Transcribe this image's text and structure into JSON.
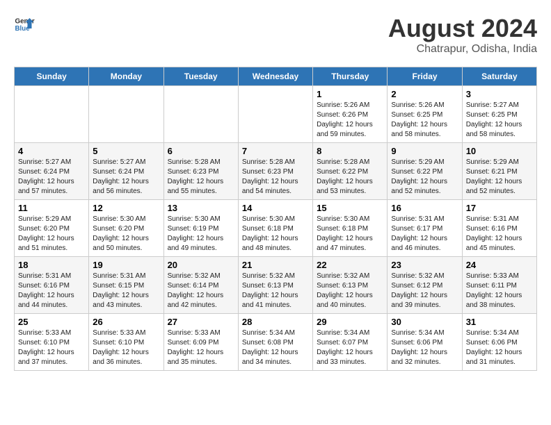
{
  "header": {
    "logo_line1": "General",
    "logo_line2": "Blue",
    "month_title": "August 2024",
    "subtitle": "Chatrapur, Odisha, India"
  },
  "days_of_week": [
    "Sunday",
    "Monday",
    "Tuesday",
    "Wednesday",
    "Thursday",
    "Friday",
    "Saturday"
  ],
  "weeks": [
    [
      {
        "day": "",
        "info": ""
      },
      {
        "day": "",
        "info": ""
      },
      {
        "day": "",
        "info": ""
      },
      {
        "day": "",
        "info": ""
      },
      {
        "day": "1",
        "info": "Sunrise: 5:26 AM\nSunset: 6:26 PM\nDaylight: 12 hours\nand 59 minutes."
      },
      {
        "day": "2",
        "info": "Sunrise: 5:26 AM\nSunset: 6:25 PM\nDaylight: 12 hours\nand 58 minutes."
      },
      {
        "day": "3",
        "info": "Sunrise: 5:27 AM\nSunset: 6:25 PM\nDaylight: 12 hours\nand 58 minutes."
      }
    ],
    [
      {
        "day": "4",
        "info": "Sunrise: 5:27 AM\nSunset: 6:24 PM\nDaylight: 12 hours\nand 57 minutes."
      },
      {
        "day": "5",
        "info": "Sunrise: 5:27 AM\nSunset: 6:24 PM\nDaylight: 12 hours\nand 56 minutes."
      },
      {
        "day": "6",
        "info": "Sunrise: 5:28 AM\nSunset: 6:23 PM\nDaylight: 12 hours\nand 55 minutes."
      },
      {
        "day": "7",
        "info": "Sunrise: 5:28 AM\nSunset: 6:23 PM\nDaylight: 12 hours\nand 54 minutes."
      },
      {
        "day": "8",
        "info": "Sunrise: 5:28 AM\nSunset: 6:22 PM\nDaylight: 12 hours\nand 53 minutes."
      },
      {
        "day": "9",
        "info": "Sunrise: 5:29 AM\nSunset: 6:22 PM\nDaylight: 12 hours\nand 52 minutes."
      },
      {
        "day": "10",
        "info": "Sunrise: 5:29 AM\nSunset: 6:21 PM\nDaylight: 12 hours\nand 52 minutes."
      }
    ],
    [
      {
        "day": "11",
        "info": "Sunrise: 5:29 AM\nSunset: 6:20 PM\nDaylight: 12 hours\nand 51 minutes."
      },
      {
        "day": "12",
        "info": "Sunrise: 5:30 AM\nSunset: 6:20 PM\nDaylight: 12 hours\nand 50 minutes."
      },
      {
        "day": "13",
        "info": "Sunrise: 5:30 AM\nSunset: 6:19 PM\nDaylight: 12 hours\nand 49 minutes."
      },
      {
        "day": "14",
        "info": "Sunrise: 5:30 AM\nSunset: 6:18 PM\nDaylight: 12 hours\nand 48 minutes."
      },
      {
        "day": "15",
        "info": "Sunrise: 5:30 AM\nSunset: 6:18 PM\nDaylight: 12 hours\nand 47 minutes."
      },
      {
        "day": "16",
        "info": "Sunrise: 5:31 AM\nSunset: 6:17 PM\nDaylight: 12 hours\nand 46 minutes."
      },
      {
        "day": "17",
        "info": "Sunrise: 5:31 AM\nSunset: 6:16 PM\nDaylight: 12 hours\nand 45 minutes."
      }
    ],
    [
      {
        "day": "18",
        "info": "Sunrise: 5:31 AM\nSunset: 6:16 PM\nDaylight: 12 hours\nand 44 minutes."
      },
      {
        "day": "19",
        "info": "Sunrise: 5:31 AM\nSunset: 6:15 PM\nDaylight: 12 hours\nand 43 minutes."
      },
      {
        "day": "20",
        "info": "Sunrise: 5:32 AM\nSunset: 6:14 PM\nDaylight: 12 hours\nand 42 minutes."
      },
      {
        "day": "21",
        "info": "Sunrise: 5:32 AM\nSunset: 6:13 PM\nDaylight: 12 hours\nand 41 minutes."
      },
      {
        "day": "22",
        "info": "Sunrise: 5:32 AM\nSunset: 6:13 PM\nDaylight: 12 hours\nand 40 minutes."
      },
      {
        "day": "23",
        "info": "Sunrise: 5:32 AM\nSunset: 6:12 PM\nDaylight: 12 hours\nand 39 minutes."
      },
      {
        "day": "24",
        "info": "Sunrise: 5:33 AM\nSunset: 6:11 PM\nDaylight: 12 hours\nand 38 minutes."
      }
    ],
    [
      {
        "day": "25",
        "info": "Sunrise: 5:33 AM\nSunset: 6:10 PM\nDaylight: 12 hours\nand 37 minutes."
      },
      {
        "day": "26",
        "info": "Sunrise: 5:33 AM\nSunset: 6:10 PM\nDaylight: 12 hours\nand 36 minutes."
      },
      {
        "day": "27",
        "info": "Sunrise: 5:33 AM\nSunset: 6:09 PM\nDaylight: 12 hours\nand 35 minutes."
      },
      {
        "day": "28",
        "info": "Sunrise: 5:34 AM\nSunset: 6:08 PM\nDaylight: 12 hours\nand 34 minutes."
      },
      {
        "day": "29",
        "info": "Sunrise: 5:34 AM\nSunset: 6:07 PM\nDaylight: 12 hours\nand 33 minutes."
      },
      {
        "day": "30",
        "info": "Sunrise: 5:34 AM\nSunset: 6:06 PM\nDaylight: 12 hours\nand 32 minutes."
      },
      {
        "day": "31",
        "info": "Sunrise: 5:34 AM\nSunset: 6:06 PM\nDaylight: 12 hours\nand 31 minutes."
      }
    ]
  ]
}
